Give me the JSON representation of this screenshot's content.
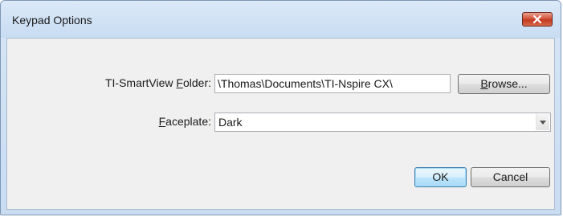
{
  "dialog": {
    "title": "Keypad Options",
    "close_icon": "close-x-icon"
  },
  "folder": {
    "label_prefix": "TI-SmartView ",
    "label_accel": "F",
    "label_suffix": "older:",
    "value": "\\Thomas\\Documents\\TI-Nspire CX\\",
    "browse_accel": "B",
    "browse_suffix": "rowse..."
  },
  "faceplate": {
    "label_accel": "F",
    "label_suffix": "aceplate:",
    "selected": "Dark",
    "dropdown_icon": "chevron-down-icon"
  },
  "actions": {
    "ok_label": "OK",
    "cancel_label": "Cancel"
  },
  "colors": {
    "close_button": "#c9472d",
    "default_button_border": "#3c7fb1",
    "titlebar": "#d4e4f6"
  }
}
